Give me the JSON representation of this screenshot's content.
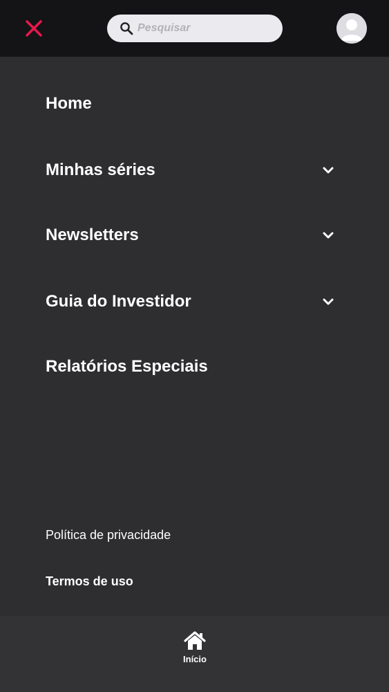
{
  "header": {
    "close_icon": "close-icon",
    "search": {
      "placeholder": "Pesquisar",
      "value": "",
      "icon": "search-icon"
    },
    "avatar_icon": "user-avatar-icon",
    "accent_color": "#e6194b"
  },
  "menu": {
    "items": [
      {
        "label": "Home",
        "has_submenu": false
      },
      {
        "label": "Minhas séries",
        "has_submenu": true
      },
      {
        "label": "Newsletters",
        "has_submenu": true
      },
      {
        "label": "Guia do Investidor",
        "has_submenu": true
      },
      {
        "label": "Relatórios Especiais",
        "has_submenu": false
      }
    ]
  },
  "footer": {
    "privacy_label": "Política de privacidade",
    "terms_label": "Termos de uso"
  },
  "bottom_nav": {
    "home_label": "Início",
    "home_icon": "home-icon"
  }
}
